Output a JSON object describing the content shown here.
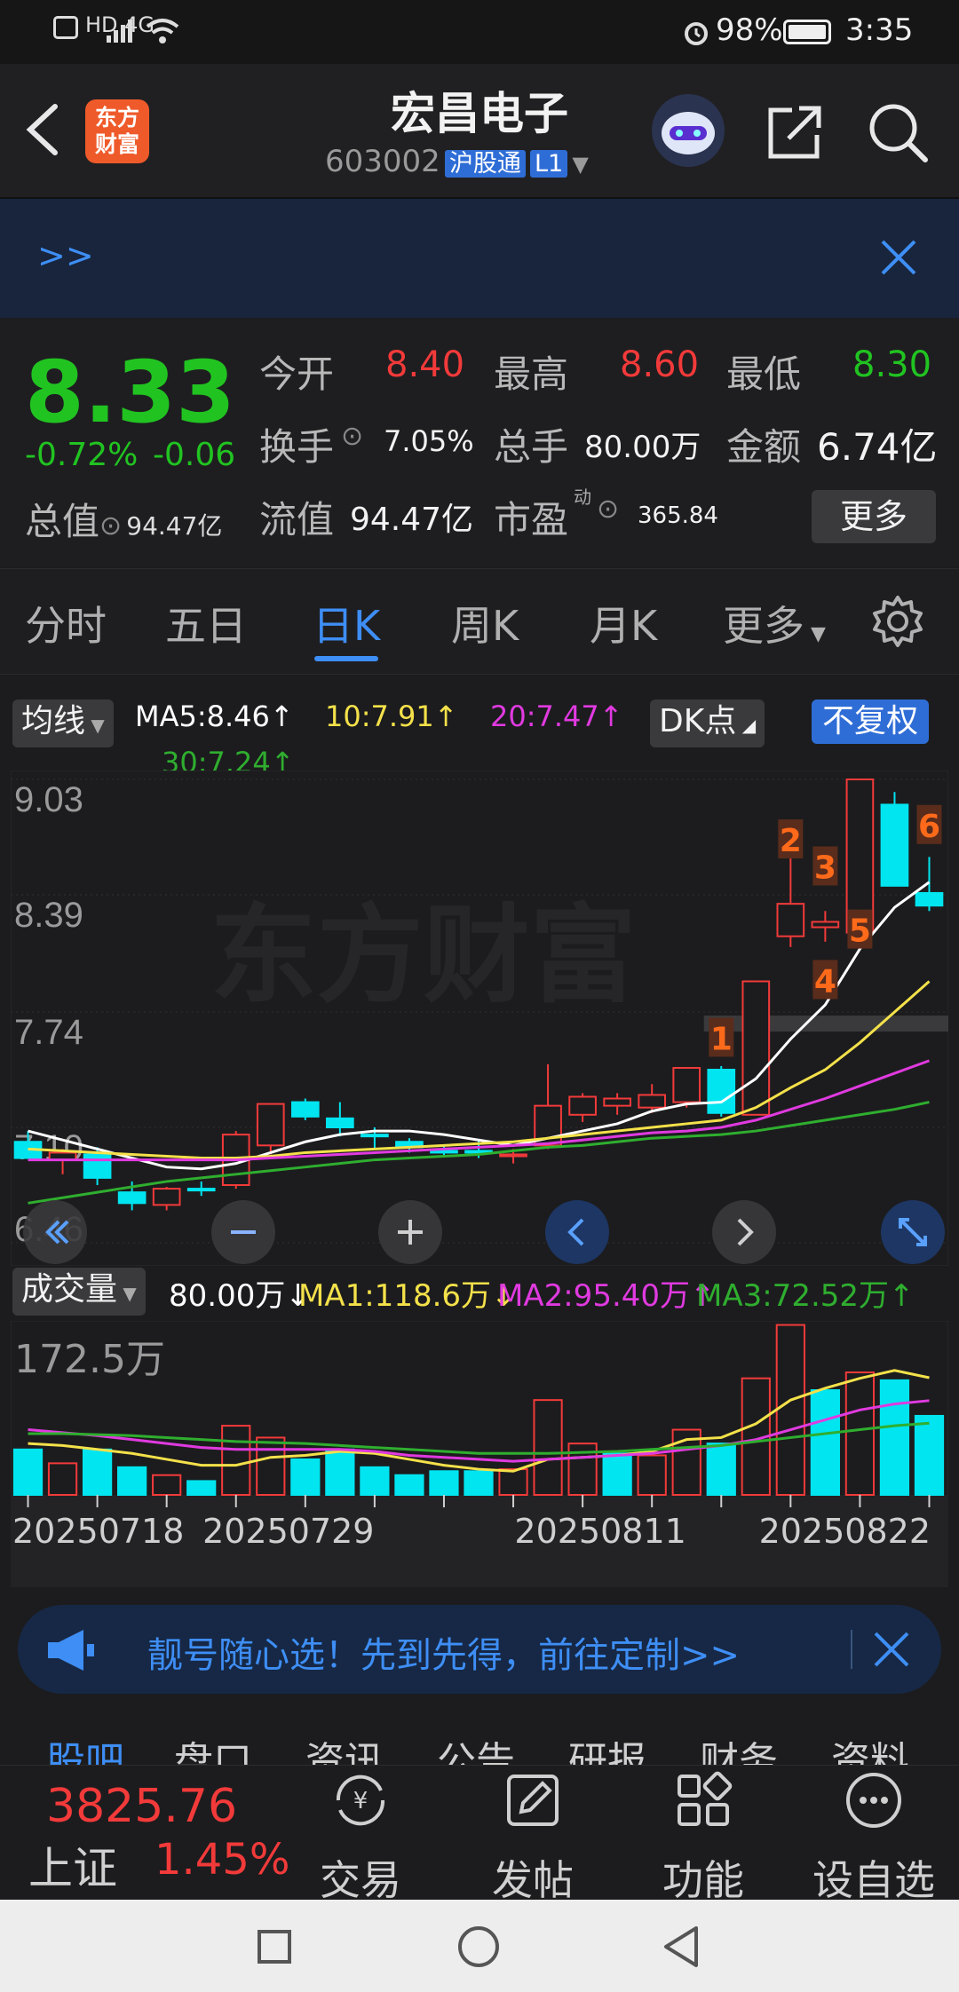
{
  "status_bar": {
    "left_icons": "HD 4G",
    "battery": "98%",
    "time": "3:35"
  },
  "header": {
    "logo_text": "东方财富",
    "title": "宏昌电子",
    "code": "603002",
    "tag": "沪股通",
    "level": "L1"
  },
  "banner": {
    "text": ">>"
  },
  "quote": {
    "price": "8.33",
    "change_pct": "-0.72%",
    "change_amt": "-0.06",
    "open_label": "今开",
    "open_value": "8.40",
    "high_label": "最高",
    "high_value": "8.60",
    "low_label": "最低",
    "low_value": "8.30",
    "turnover_label": "换手",
    "turnover_value": "7.05%",
    "volume_label": "总手",
    "volume_value": "80.00万",
    "amount_label": "金额",
    "amount_value": "6.74亿",
    "mktcap_label": "总值",
    "mktcap_value": "94.47亿",
    "float_label": "流值",
    "float_value": "94.47亿",
    "pe_label": "市盈",
    "pe_sup": "动",
    "pe_value": "365.84",
    "more_label": "更多"
  },
  "tabs": [
    "分时",
    "五日",
    "日K",
    "周K",
    "月K",
    "更多"
  ],
  "active_tab": "日K",
  "ma_bar": {
    "selector": "均线",
    "ma5": "MA5:8.46↑",
    "ma10": "10:7.91↑",
    "ma20": "20:7.47↑",
    "ma30": "30:7.24↑",
    "dk_label": "DK点",
    "adjust_label": "不复权"
  },
  "vol_bar": {
    "selector": "成交量",
    "vol": "80.00万↓",
    "ma1": "MA1:118.6万↓",
    "ma2": "MA2:95.40万↑",
    "ma3": "MA3:72.52万↑"
  },
  "colors": {
    "up": "#f23a3a",
    "down": "#00e5f0",
    "ma5": "#ffffff",
    "ma10": "#f4e14a",
    "ma20": "#e03ae0",
    "ma30": "#2fae2f"
  },
  "chart_data": [
    {
      "type": "candlestick",
      "title": "日K",
      "y_ticks": [
        "9.03",
        "8.39",
        "7.74",
        "7.10",
        "6.46"
      ],
      "ylim": [
        6.46,
        9.03
      ],
      "watermark": "东方财富",
      "candles": [
        {
          "o": 7.02,
          "h": 7.08,
          "l": 6.93,
          "c": 6.93
        },
        {
          "o": 6.92,
          "h": 6.98,
          "l": 6.84,
          "c": 6.96
        },
        {
          "o": 6.95,
          "h": 6.99,
          "l": 6.78,
          "c": 6.82
        },
        {
          "o": 6.74,
          "h": 6.8,
          "l": 6.64,
          "c": 6.68
        },
        {
          "o": 6.67,
          "h": 6.77,
          "l": 6.64,
          "c": 6.76
        },
        {
          "o": 6.76,
          "h": 6.8,
          "l": 6.72,
          "c": 6.75
        },
        {
          "o": 6.78,
          "h": 7.08,
          "l": 6.76,
          "c": 7.06
        },
        {
          "o": 7.0,
          "h": 7.23,
          "l": 6.95,
          "c": 7.23
        },
        {
          "o": 7.24,
          "h": 7.26,
          "l": 7.14,
          "c": 7.16
        },
        {
          "o": 7.15,
          "h": 7.24,
          "l": 7.05,
          "c": 7.1
        },
        {
          "o": 7.06,
          "h": 7.1,
          "l": 6.98,
          "c": 7.05
        },
        {
          "o": 7.02,
          "h": 7.04,
          "l": 6.96,
          "c": 6.99
        },
        {
          "o": 6.97,
          "h": 7.0,
          "l": 6.94,
          "c": 6.96
        },
        {
          "o": 6.97,
          "h": 7.03,
          "l": 6.93,
          "c": 6.96
        },
        {
          "o": 6.94,
          "h": 6.98,
          "l": 6.9,
          "c": 6.95
        },
        {
          "o": 7.0,
          "h": 7.45,
          "l": 6.98,
          "c": 7.22
        },
        {
          "o": 7.17,
          "h": 7.29,
          "l": 7.13,
          "c": 7.27
        },
        {
          "o": 7.22,
          "h": 7.29,
          "l": 7.17,
          "c": 7.26
        },
        {
          "o": 7.21,
          "h": 7.34,
          "l": 7.18,
          "c": 7.28
        },
        {
          "o": 7.24,
          "h": 7.43,
          "l": 7.21,
          "c": 7.43
        },
        {
          "o": 7.42,
          "h": 7.44,
          "l": 7.16,
          "c": 7.18
        },
        {
          "o": 7.17,
          "h": 7.91,
          "l": 7.17,
          "c": 7.91
        },
        {
          "o": 8.16,
          "h": 8.6,
          "l": 8.1,
          "c": 8.34
        },
        {
          "o": 8.21,
          "h": 8.3,
          "l": 8.13,
          "c": 8.24
        },
        {
          "o": 8.18,
          "h": 9.03,
          "l": 8.17,
          "c": 9.03
        },
        {
          "o": 8.89,
          "h": 8.96,
          "l": 8.44,
          "c": 8.44
        },
        {
          "o": 8.4,
          "h": 8.6,
          "l": 8.3,
          "c": 8.33
        }
      ],
      "ma5": [
        7.08,
        7.03,
        6.98,
        6.93,
        6.88,
        6.87,
        6.9,
        6.96,
        7.02,
        7.06,
        7.08,
        7.08,
        7.06,
        7.03,
        7.0,
        7.04,
        7.08,
        7.12,
        7.19,
        7.23,
        7.24,
        7.37,
        7.59,
        7.78,
        8.09,
        8.32,
        8.46
      ],
      "ma10": [
        6.98,
        6.97,
        6.96,
        6.95,
        6.94,
        6.93,
        6.93,
        6.94,
        6.96,
        6.97,
        6.98,
        6.99,
        7.0,
        7.01,
        7.02,
        7.04,
        7.06,
        7.08,
        7.1,
        7.12,
        7.14,
        7.21,
        7.32,
        7.42,
        7.57,
        7.74,
        7.91
      ],
      "ma20": [
        6.92,
        6.92,
        6.92,
        6.92,
        6.92,
        6.92,
        6.92,
        6.93,
        6.94,
        6.95,
        6.96,
        6.97,
        6.98,
        6.99,
        7.0,
        7.01,
        7.03,
        7.05,
        7.07,
        7.08,
        7.1,
        7.14,
        7.2,
        7.26,
        7.33,
        7.4,
        7.47
      ],
      "ma30": [
        6.68,
        6.71,
        6.74,
        6.77,
        6.8,
        6.82,
        6.84,
        6.86,
        6.88,
        6.9,
        6.92,
        6.93,
        6.94,
        6.95,
        6.97,
        6.99,
        7.0,
        7.02,
        7.04,
        7.05,
        7.06,
        7.08,
        7.11,
        7.14,
        7.17,
        7.2,
        7.24
      ],
      "annotations": [
        {
          "label": "1",
          "candle": 20,
          "price": 7.6,
          "color": "#ff6a1a"
        },
        {
          "label": "2",
          "candle": 22,
          "price": 8.7,
          "color": "#ff6a1a"
        },
        {
          "label": "3",
          "candle": 23,
          "price": 8.55,
          "color": "#ff6a1a"
        },
        {
          "label": "4",
          "candle": 23,
          "price": 7.92,
          "color": "#ff6a1a"
        },
        {
          "label": "5",
          "candle": 24,
          "price": 8.2,
          "color": "#ff6a1a"
        },
        {
          "label": "6",
          "candle": 26,
          "price": 8.78,
          "color": "#ff6a1a"
        }
      ]
    },
    {
      "type": "bar",
      "title": "成交量",
      "y_ticks": [
        "172.5万"
      ],
      "ylim": [
        0,
        172.5
      ],
      "x_ticks": [
        "20250718",
        "20250729",
        "20250811",
        "20250822"
      ],
      "values": [
        46,
        32,
        46,
        28,
        20,
        14,
        70,
        58,
        36,
        46,
        28,
        20,
        24,
        24,
        26,
        96,
        52,
        42,
        40,
        66,
        52,
        118,
        172,
        106,
        124,
        116,
        80
      ],
      "up": [
        false,
        true,
        false,
        false,
        true,
        false,
        true,
        true,
        false,
        false,
        false,
        false,
        false,
        false,
        true,
        true,
        true,
        false,
        true,
        true,
        false,
        true,
        true,
        false,
        true,
        false,
        false
      ],
      "ma1": [
        52,
        50,
        46,
        42,
        36,
        30,
        30,
        38,
        40,
        44,
        42,
        36,
        30,
        26,
        24,
        36,
        38,
        40,
        44,
        56,
        58,
        72,
        96,
        108,
        118,
        126,
        118.6
      ],
      "ma2": [
        66,
        63,
        60,
        56,
        52,
        48,
        46,
        46,
        46,
        46,
        44,
        40,
        38,
        36,
        34,
        36,
        38,
        40,
        42,
        46,
        50,
        56,
        66,
        76,
        86,
        92,
        95.4
      ],
      "ma3": [
        62,
        62,
        61,
        60,
        58,
        56,
        54,
        53,
        52,
        50,
        48,
        46,
        44,
        42,
        42,
        42,
        43,
        44,
        46,
        48,
        50,
        54,
        58,
        62,
        66,
        70,
        72.52
      ]
    }
  ],
  "ad": {
    "text": "靓号随心选！先到先得，前往定制>>"
  },
  "subtabs": [
    "股吧",
    "盘口",
    "资讯",
    "公告",
    "研报",
    "财务",
    "资料"
  ],
  "bottom_nav": {
    "index_value": "3825.76",
    "index_name": "上证",
    "index_change": "1.45%",
    "items": [
      "交易",
      "发帖",
      "功能",
      "设自选"
    ]
  }
}
